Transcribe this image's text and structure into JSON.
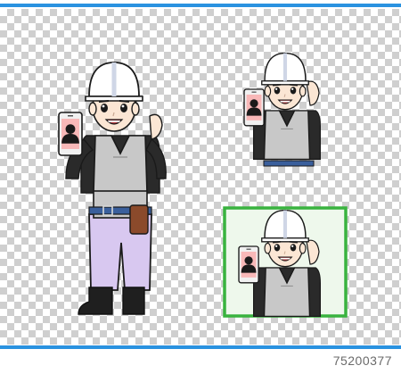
{
  "image": {
    "stock_id": "75200377",
    "colors": {
      "stripe": "#2a92e0",
      "frame": "#39b33f",
      "helmet": "#ffffff",
      "vest": "#c8c8c8",
      "shirt": "#2a2a2a",
      "pants": "#d8c8f0",
      "skin": "#fbe6d4",
      "phone_screen": "#f8b8b8"
    },
    "icons": [
      "phone-icon",
      "person-silhouette-icon"
    ]
  }
}
